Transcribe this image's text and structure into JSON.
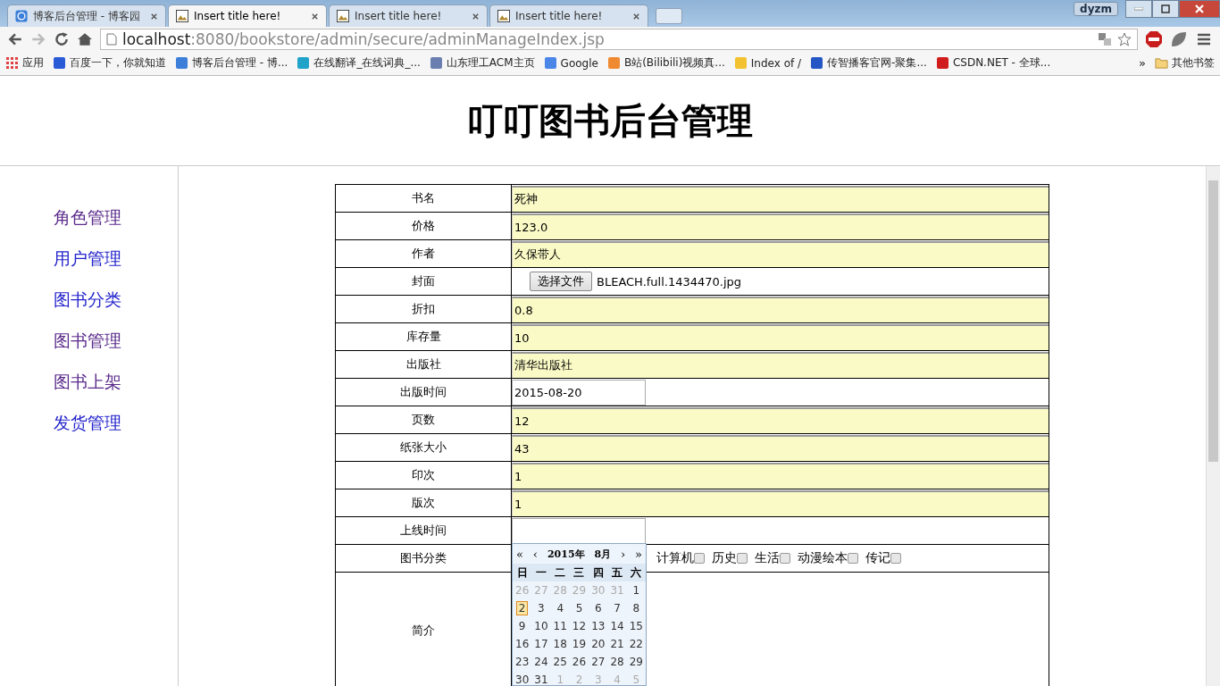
{
  "browser": {
    "tabs": [
      {
        "title": "博客后台管理 - 博客园",
        "selected": false
      },
      {
        "title": "Insert title here!",
        "selected": true
      },
      {
        "title": "Insert title here!",
        "selected": false
      },
      {
        "title": "Insert title here!",
        "selected": false
      }
    ],
    "user": "dyzm",
    "url_host": "localhost",
    "url_path": ":8080/bookstore/admin/secure/adminManageIndex.jsp",
    "bookmarks": [
      {
        "label": "应用",
        "color": "#e04040"
      },
      {
        "label": "百度一下，你就知道",
        "color": "#2a5bd7"
      },
      {
        "label": "博客后台管理 - 博...",
        "color": "#3b7fd9"
      },
      {
        "label": "在线翻译_在线词典_...",
        "color": "#1fa3c9"
      },
      {
        "label": "山东理工ACM主页",
        "color": "#6a7fb0"
      },
      {
        "label": "Google",
        "color": "#4a86e8"
      },
      {
        "label": "B站(Bilibili)视频真...",
        "color": "#f08a30"
      },
      {
        "label": "Index of /",
        "color": "#f2c230"
      },
      {
        "label": "传智播客官网-聚集...",
        "color": "#2457c5"
      },
      {
        "label": "CSDN.NET - 全球...",
        "color": "#d01c1c"
      }
    ],
    "more": "»",
    "other_bookmarks": "其他书签"
  },
  "page": {
    "title": "叮叮图书后台管理",
    "sidebar": [
      {
        "label": "角色管理",
        "visited": true
      },
      {
        "label": "用户管理",
        "visited": false
      },
      {
        "label": "图书分类",
        "visited": false
      },
      {
        "label": "图书管理",
        "visited": true
      },
      {
        "label": "图书上架",
        "visited": true
      },
      {
        "label": "发货管理",
        "visited": false
      }
    ],
    "form": [
      {
        "label": "书名",
        "kind": "text",
        "value": "死神"
      },
      {
        "label": "价格",
        "kind": "text",
        "value": "123.0"
      },
      {
        "label": "作者",
        "kind": "text",
        "value": "久保带人"
      },
      {
        "label": "封面",
        "kind": "file",
        "button": "选择文件",
        "value": "BLEACH.full.1434470.jpg"
      },
      {
        "label": "折扣",
        "kind": "text",
        "value": "0.8"
      },
      {
        "label": "库存量",
        "kind": "text",
        "value": "10"
      },
      {
        "label": "出版社",
        "kind": "text",
        "value": "清华出版社"
      },
      {
        "label": "出版时间",
        "kind": "date",
        "value": "2015-08-20"
      },
      {
        "label": "页数",
        "kind": "text",
        "value": "12"
      },
      {
        "label": "纸张大小",
        "kind": "text",
        "value": "43"
      },
      {
        "label": "印次",
        "kind": "text",
        "value": "1"
      },
      {
        "label": "版次",
        "kind": "text",
        "value": "1"
      },
      {
        "label": "上线时间",
        "kind": "date"
      },
      {
        "label": "图书分类",
        "kind": "checkboxes",
        "options": [
          {
            "label": "计算机",
            "checked": false
          },
          {
            "label": "历史",
            "checked": false
          },
          {
            "label": "生活",
            "checked": false
          },
          {
            "label": "动漫绘本",
            "checked": false
          },
          {
            "label": "传记",
            "checked": false
          }
        ]
      },
      {
        "label": "简介",
        "kind": "textarea"
      }
    ],
    "calendar": {
      "nav": [
        "«",
        "‹",
        "›",
        "»"
      ],
      "year": "2015年",
      "month": "8月",
      "weekdays": [
        "日",
        "一",
        "二",
        "三",
        "四",
        "五",
        "六"
      ],
      "weeks": [
        [
          {
            "day": "26",
            "muted": true,
            "selected": false
          },
          {
            "day": "27",
            "muted": true,
            "selected": false
          },
          {
            "day": "28",
            "muted": true,
            "selected": false
          },
          {
            "day": "29",
            "muted": true,
            "selected": false
          },
          {
            "day": "30",
            "muted": true,
            "selected": false
          },
          {
            "day": "31",
            "muted": true,
            "selected": false
          },
          {
            "day": "1",
            "muted": false,
            "selected": false
          }
        ],
        [
          {
            "day": "2",
            "muted": false,
            "selected": true
          },
          {
            "day": "3",
            "muted": false,
            "selected": false
          },
          {
            "day": "4",
            "muted": false,
            "selected": false
          },
          {
            "day": "5",
            "muted": false,
            "selected": false
          },
          {
            "day": "6",
            "muted": false,
            "selected": false
          },
          {
            "day": "7",
            "muted": false,
            "selected": false
          },
          {
            "day": "8",
            "muted": false,
            "selected": false
          }
        ],
        [
          {
            "day": "9",
            "muted": false,
            "selected": false
          },
          {
            "day": "10",
            "muted": false,
            "selected": false
          },
          {
            "day": "11",
            "muted": false,
            "selected": false
          },
          {
            "day": "12",
            "muted": false,
            "selected": false
          },
          {
            "day": "13",
            "muted": false,
            "selected": false
          },
          {
            "day": "14",
            "muted": false,
            "selected": false
          },
          {
            "day": "15",
            "muted": false,
            "selected": false
          }
        ],
        [
          {
            "day": "16",
            "muted": false,
            "selected": false
          },
          {
            "day": "17",
            "muted": false,
            "selected": false
          },
          {
            "day": "18",
            "muted": false,
            "selected": false
          },
          {
            "day": "19",
            "muted": false,
            "selected": false
          },
          {
            "day": "20",
            "muted": false,
            "selected": false
          },
          {
            "day": "21",
            "muted": false,
            "selected": false
          },
          {
            "day": "22",
            "muted": false,
            "selected": false
          }
        ],
        [
          {
            "day": "23",
            "muted": false,
            "selected": false
          },
          {
            "day": "24",
            "muted": false,
            "selected": false
          },
          {
            "day": "25",
            "muted": false,
            "selected": false
          },
          {
            "day": "26",
            "muted": false,
            "selected": false
          },
          {
            "day": "27",
            "muted": false,
            "selected": false
          },
          {
            "day": "28",
            "muted": false,
            "selected": false
          },
          {
            "day": "29",
            "muted": false,
            "selected": false
          }
        ],
        [
          {
            "day": "30",
            "muted": false,
            "selected": false
          },
          {
            "day": "31",
            "muted": false,
            "selected": false
          },
          {
            "day": "1",
            "muted": true,
            "selected": false
          },
          {
            "day": "2",
            "muted": true,
            "selected": false
          },
          {
            "day": "3",
            "muted": true,
            "selected": false
          },
          {
            "day": "4",
            "muted": true,
            "selected": false
          },
          {
            "day": "5",
            "muted": true,
            "selected": false
          }
        ]
      ]
    }
  }
}
